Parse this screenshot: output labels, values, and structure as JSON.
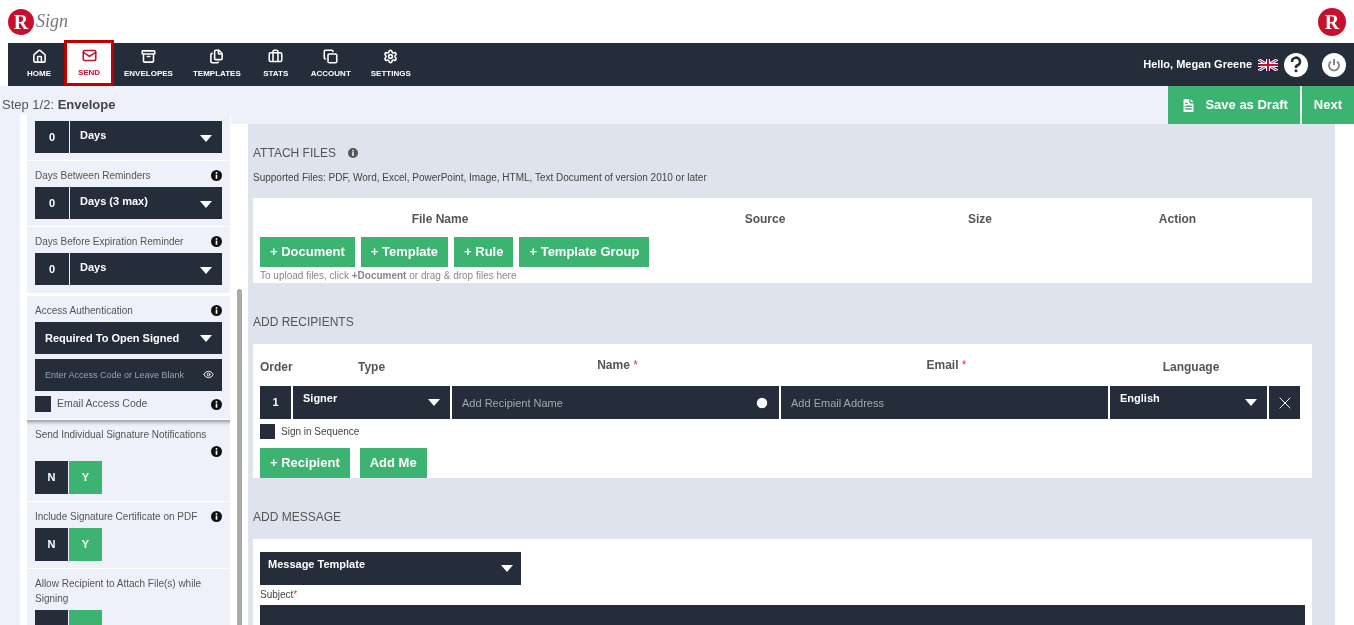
{
  "header": {
    "logo": {
      "mark": "R",
      "wordmark": "Sign"
    },
    "right_logo": "R"
  },
  "nav": {
    "items": [
      {
        "label": "HOME",
        "selected": false,
        "highlighted": false
      },
      {
        "label": "SEND",
        "selected": true,
        "highlighted": true
      },
      {
        "label": "ENVELOPES",
        "selected": false,
        "highlighted": false
      },
      {
        "label": "TEMPLATES",
        "selected": false,
        "highlighted": false
      },
      {
        "label": "STATS",
        "selected": false,
        "highlighted": false
      },
      {
        "label": "ACCOUNT",
        "selected": false,
        "highlighted": false
      },
      {
        "label": "SETTINGS",
        "selected": false,
        "highlighted": false
      }
    ],
    "greeting": "Hello, Megan Greene"
  },
  "step_bar": {
    "step": "Step 1/2:",
    "title": "Envelope",
    "buttons": [
      {
        "label": "Save as Draft",
        "icon": true
      },
      {
        "label": "Next",
        "icon": false
      }
    ]
  },
  "sidebar": {
    "sections": [
      {
        "kind": "number_select",
        "number": "0",
        "select": "Days",
        "highlighted": false
      },
      {
        "kind": "number_select",
        "label": "Days Between Reminders",
        "info": true,
        "number": "0",
        "select": "Days (3 max)",
        "highlighted": false
      },
      {
        "kind": "number_select",
        "label": "Days Before Expiration Reminder",
        "info": true,
        "number": "0",
        "select": "Days",
        "highlighted": false
      },
      {
        "kind": "access",
        "label": "Access Authentication",
        "info": true,
        "select": "Required To Open Signed",
        "placeholder": "Enter Access Code or Leave Blank",
        "checkbox": {
          "label": "Email Access Code",
          "checked": false
        },
        "highlighted": true
      },
      {
        "kind": "toggle",
        "label": "Send Individual Signature Notifications",
        "info": true,
        "info_below": true,
        "options": [
          {
            "label": "N",
            "selected": false
          },
          {
            "label": "Y",
            "selected": true
          }
        ],
        "highlighted": false
      },
      {
        "kind": "toggle",
        "label": "Include Signature Certificate on PDF",
        "info": true,
        "options": [
          {
            "label": "N",
            "selected": false
          },
          {
            "label": "Y",
            "selected": true
          }
        ],
        "highlighted": false
      },
      {
        "kind": "toggle",
        "label": "Allow Recipient to Attach File(s) while Signing",
        "options": [
          {
            "selected": false
          },
          {
            "selected": true
          }
        ],
        "highlighted": false
      }
    ]
  },
  "attach_files": {
    "title": "ATTACH FILES",
    "supported": "Supported Files: PDF, Word, Excel, PowerPoint, Image, HTML, Text Document of version 2010 or later",
    "columns": [
      "File Name",
      "Source",
      "Size",
      "Action"
    ],
    "buttons": [
      "+ Document",
      "+ Template",
      "+ Rule",
      "+ Template Group"
    ],
    "hint": "To upload files, click **+Document** or drag & drop files here"
  },
  "add_recipients": {
    "title": "ADD RECIPIENTS",
    "columns": [
      {
        "label": "Order"
      },
      {
        "label": "Type"
      },
      {
        "label": "Name",
        "required_mark": "*"
      },
      {
        "label": "Email",
        "required_mark": "*"
      },
      {
        "label": "Language"
      }
    ],
    "rows": [
      {
        "order": "1",
        "type": "Signer",
        "name_placeholder": "Add Recipient Name",
        "email_placeholder": "Add Email Address",
        "language": "English"
      }
    ],
    "sequence": {
      "label": "Sign in Sequence",
      "checked": false
    },
    "buttons": [
      "+ Recipient",
      "Add Me"
    ]
  },
  "add_message": {
    "title": "ADD MESSAGE",
    "template": "Message Template",
    "subject_label": "Subject",
    "subject_mark": "*"
  }
}
